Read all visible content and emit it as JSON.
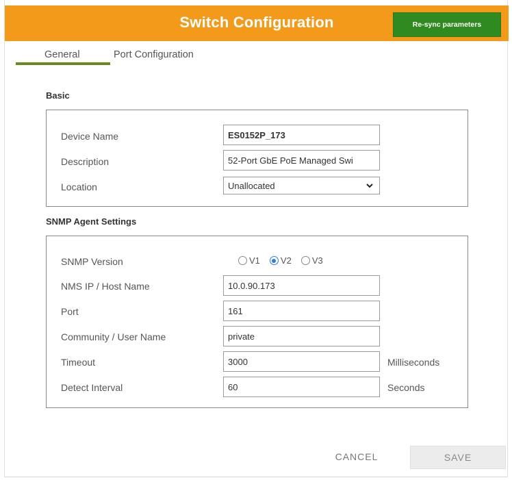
{
  "header": {
    "title": "Switch Configuration",
    "resync_label": "Re-sync parameters",
    "color": "#f39a1a",
    "resync_color": "#2f8a1f"
  },
  "tabs": [
    {
      "label": "General",
      "active": true
    },
    {
      "label": "Port Configuration",
      "active": false
    }
  ],
  "basic": {
    "title": "Basic",
    "device_name": {
      "label": "Device Name",
      "value": "ES0152P_173"
    },
    "description": {
      "label": "Description",
      "value": "52-Port GbE PoE Managed Swi"
    },
    "location": {
      "label": "Location",
      "value": "Unallocated",
      "icon": "chevron-down-icon"
    }
  },
  "snmp": {
    "title": "SNMP Agent Settings",
    "version": {
      "label": "SNMP Version",
      "options": [
        {
          "label": "V1",
          "checked": false
        },
        {
          "label": "V2",
          "checked": true
        },
        {
          "label": "V3",
          "checked": false
        }
      ]
    },
    "nms_ip": {
      "label": "NMS IP / Host Name",
      "value": "10.0.90.173"
    },
    "port": {
      "label": "Port",
      "value": "161"
    },
    "community": {
      "label": "Community / User Name",
      "value": "private"
    },
    "timeout": {
      "label": "Timeout",
      "value": "3000",
      "suffix": "Milliseconds"
    },
    "detect_interval": {
      "label": "Detect Interval",
      "value": "60",
      "suffix": "Seconds"
    }
  },
  "footer": {
    "cancel_label": "CANCEL",
    "save_label": "SAVE"
  }
}
